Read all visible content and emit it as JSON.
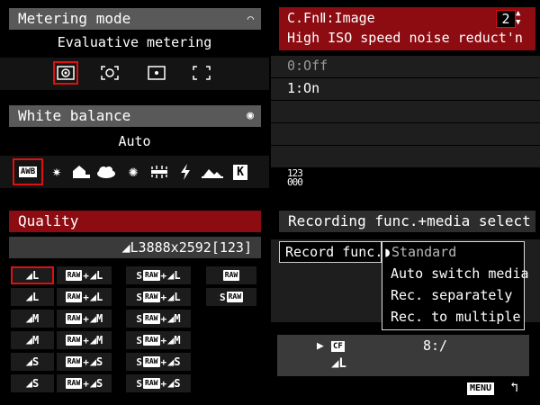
{
  "metering": {
    "header": "Metering mode",
    "value": "Evaluative metering",
    "icons": [
      "evaluative-icon",
      "partial-icon",
      "spot-icon",
      "center-weighted-icon"
    ]
  },
  "white_balance": {
    "header": "White balance",
    "value": "Auto",
    "awb_label": "AWB",
    "k_label": "K",
    "icons": [
      "awb-icon",
      "daylight-icon",
      "shade-icon",
      "cloudy-icon",
      "tungsten-icon",
      "fluorescent-icon",
      "flash-icon",
      "custom-wb-icon",
      "kelvin-icon"
    ]
  },
  "custom_function": {
    "header": "C.FnⅡ:Image",
    "subtitle": "High ISO speed noise reduct'n",
    "page": "2",
    "options": [
      "0:Off",
      "1:On"
    ],
    "numbers_top": "123",
    "numbers_bottom": "000"
  },
  "quality": {
    "header": "Quality",
    "readout": "◢L3888x2592[123]",
    "raw_label": "RAW",
    "s_label": "S",
    "plus": "+",
    "col1_sizes": [
      "L",
      "L",
      "M",
      "M",
      "S",
      "S"
    ],
    "col2_sizes": [
      "L",
      "L",
      "M",
      "M",
      "S",
      "S"
    ],
    "col3_sizes": [
      "L",
      "L",
      "M",
      "M",
      "S",
      "S"
    ]
  },
  "recording": {
    "header": "Recording func.+media select",
    "label": "Record func.",
    "options": [
      "Standard",
      "Auto switch media",
      "Rec. separately",
      "Rec. to multiple"
    ],
    "cf_label": "CF",
    "card_path": "8:/",
    "menu_label": "MENU"
  }
}
